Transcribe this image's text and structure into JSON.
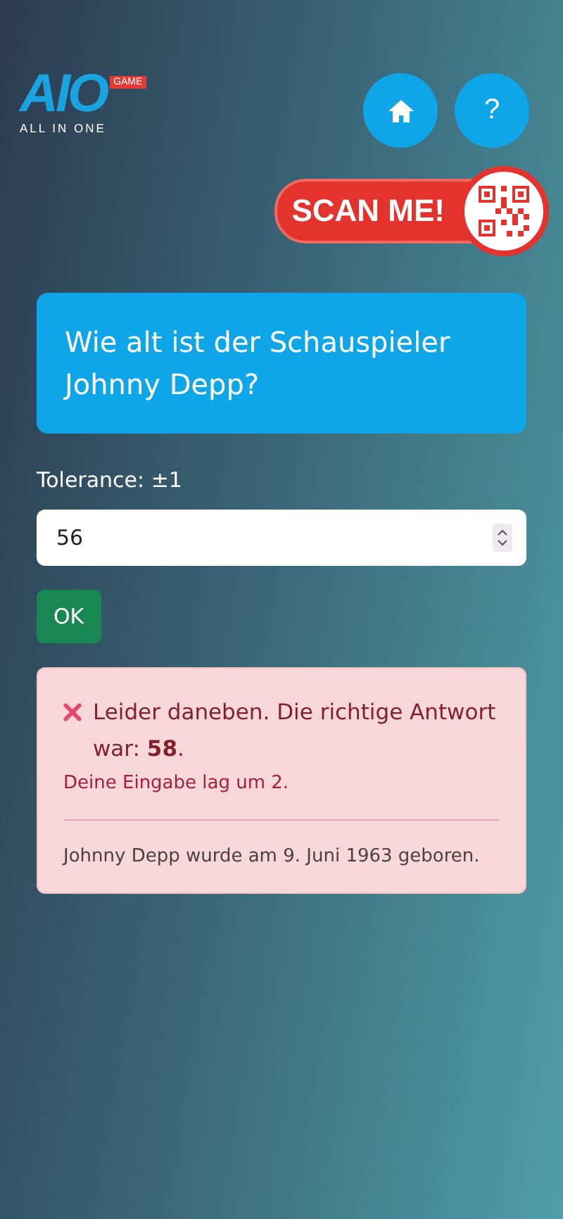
{
  "logo": {
    "mark": "AIO",
    "tag": "GAME",
    "subtitle": "ALL IN ONE"
  },
  "nav_buttons": [
    {
      "kind": "home"
    },
    {
      "kind": "help",
      "label": "?"
    }
  ],
  "scan_badge": {
    "label": "SCAN ME!"
  },
  "question": "Wie alt ist der Schauspieler Johnny Depp?",
  "tolerance_label": "Tolerance: ±1",
  "answer_input": {
    "value": "56"
  },
  "submit_button": "OK",
  "result": {
    "correct": false,
    "message": "Leider daneben. Die richtige Antwort war: **58**.",
    "difference": "Deine Eingabe lag um 2.",
    "fact": "Johnny Depp wurde am 9. Juni 1963 geboren."
  }
}
